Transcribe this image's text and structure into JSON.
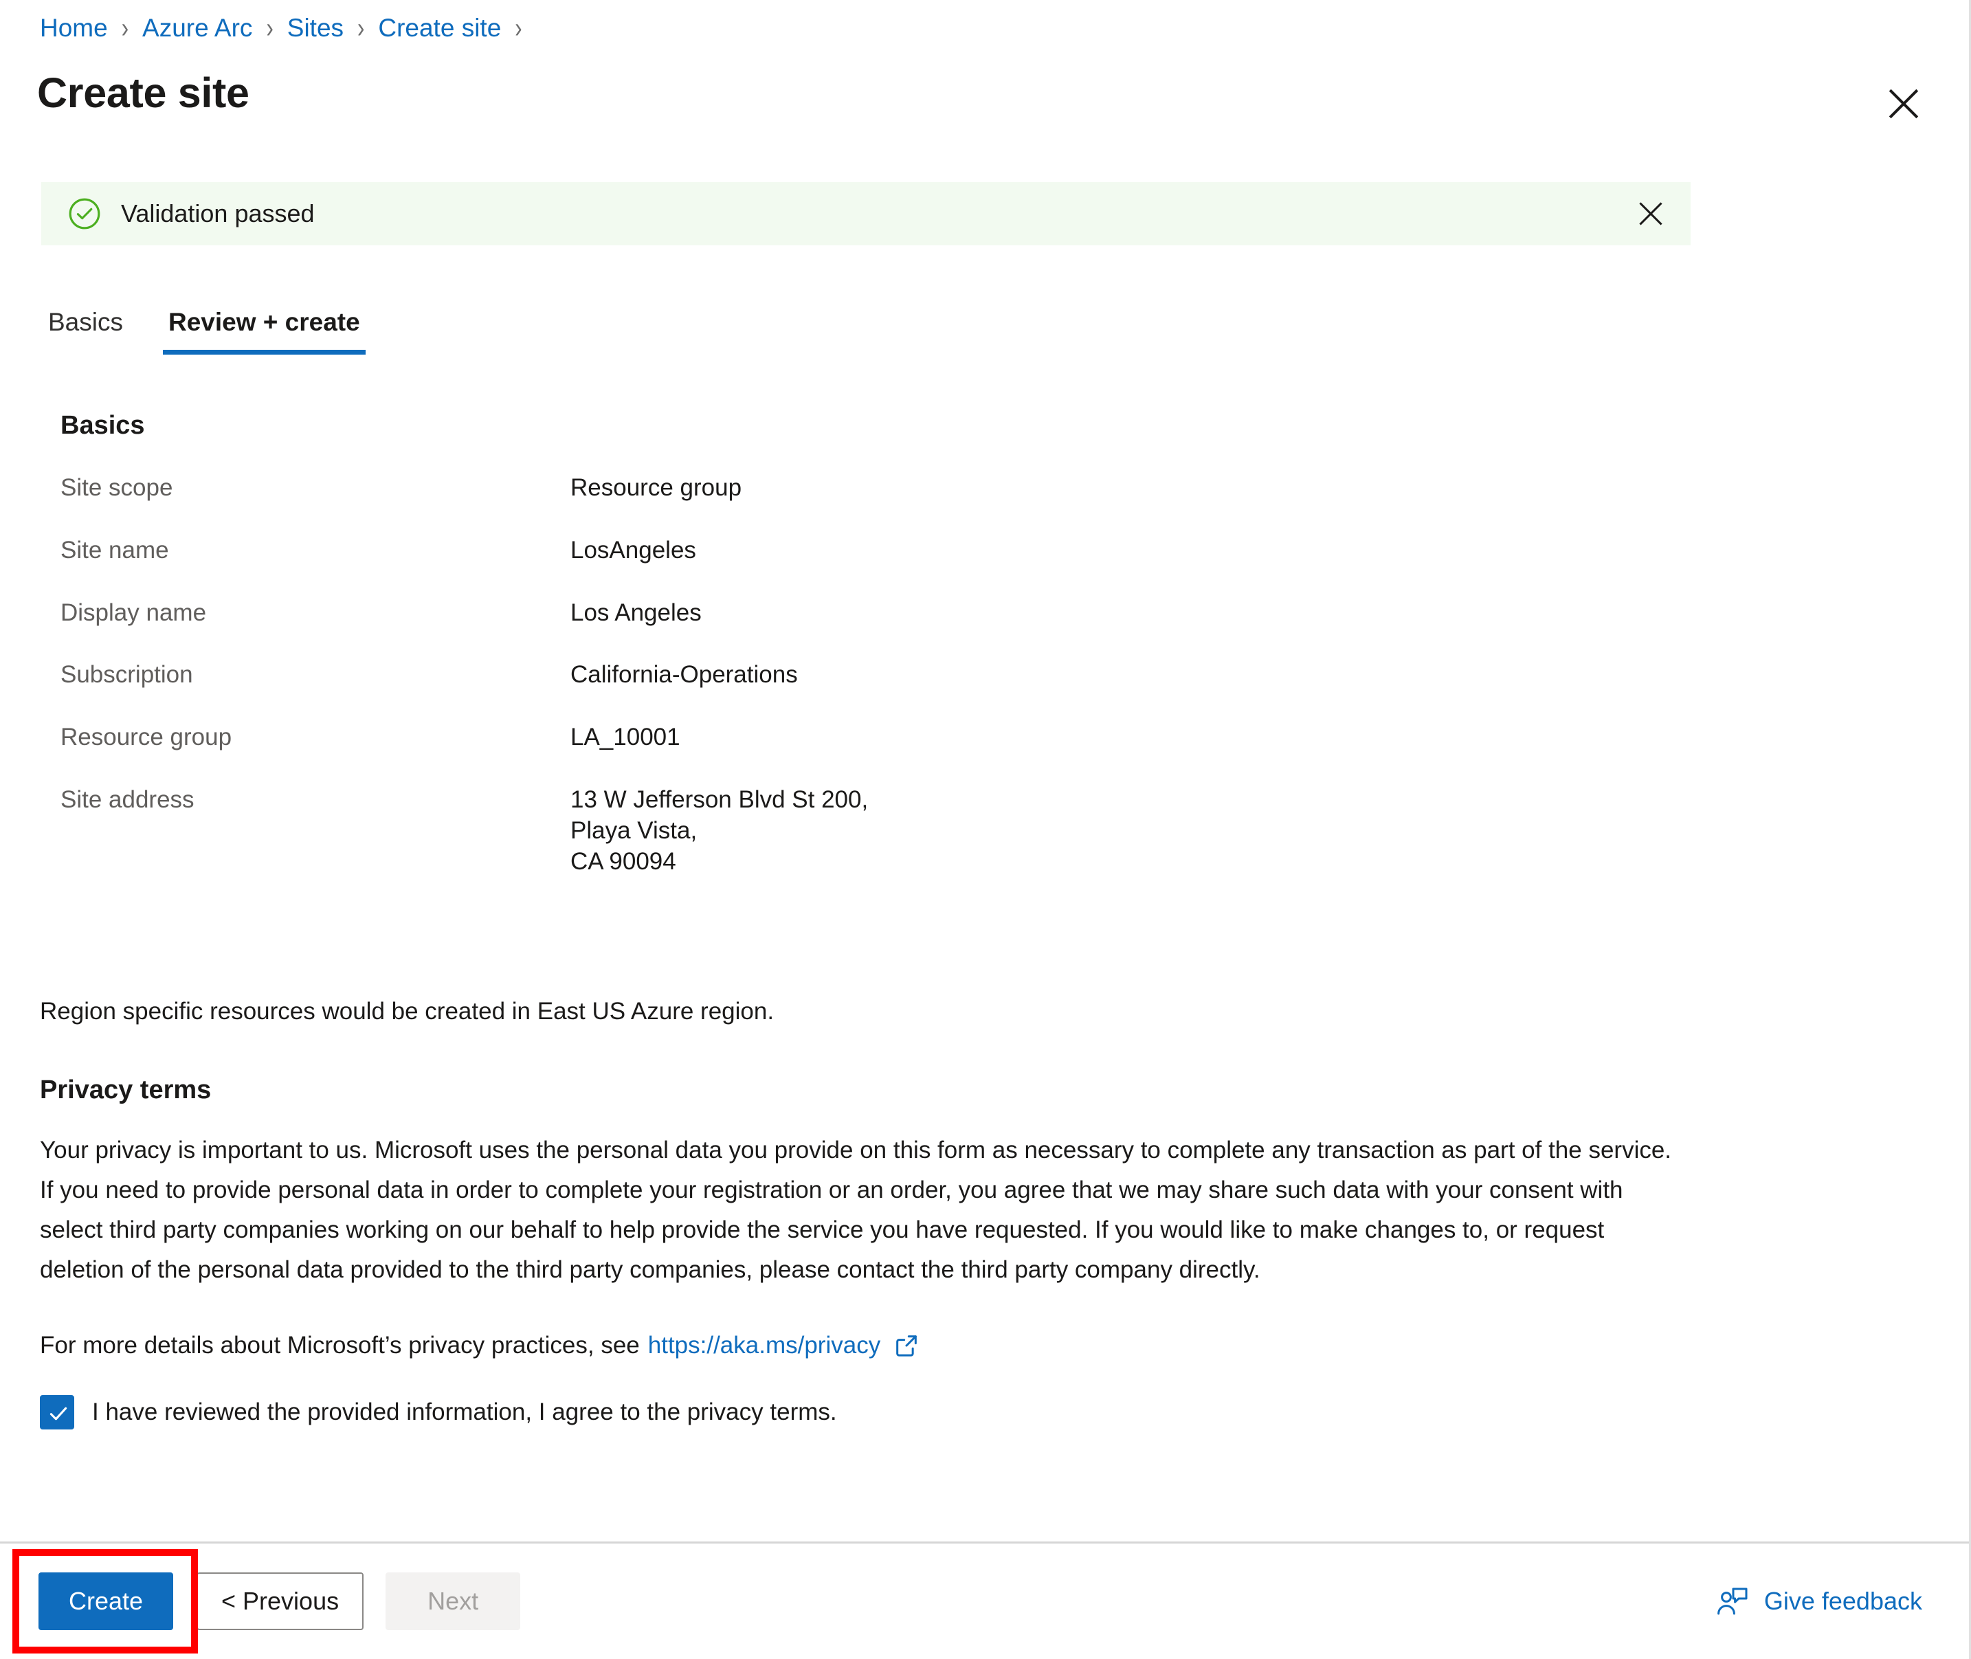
{
  "breadcrumb": {
    "items": [
      {
        "label": "Home"
      },
      {
        "label": "Azure Arc"
      },
      {
        "label": "Sites"
      },
      {
        "label": "Create site"
      }
    ],
    "separator": "›"
  },
  "header": {
    "title": "Create site",
    "close_icon": "close-icon"
  },
  "banner": {
    "icon": "check-circle-icon",
    "message": "Validation passed",
    "close_icon": "close-icon",
    "background": "#f2faf0",
    "icon_color": "#4caf20"
  },
  "tabs": [
    {
      "label": "Basics",
      "active": false
    },
    {
      "label": "Review + create",
      "active": true
    }
  ],
  "basics": {
    "heading": "Basics",
    "rows": [
      {
        "label": "Site scope",
        "value": "Resource group"
      },
      {
        "label": "Site name",
        "value": "LosAngeles"
      },
      {
        "label": "Display name",
        "value": "Los Angeles"
      },
      {
        "label": "Subscription",
        "value": "California-Operations"
      },
      {
        "label": "Resource group",
        "value": "LA_10001"
      },
      {
        "label": "Site address",
        "value": "13 W Jefferson Blvd St 200,\nPlaya Vista,\nCA 90094"
      }
    ]
  },
  "region_note": "Region specific resources would be created in East US Azure region.",
  "privacy": {
    "heading": "Privacy terms",
    "body": "Your privacy is important to us. Microsoft uses the personal data you provide on this form as necessary to complete any transaction as part of the service. If you need to provide personal data in order to complete your registration or an order, you agree that we may share such data with your consent with select third party companies working on our behalf to help provide the service you have requested. If you would like to make changes to, or request deletion of the personal data provided to the third party companies, please contact the third party company directly.",
    "more_details_prefix": "For more details about Microsoft’s privacy practices, see",
    "link_text": "https://aka.ms/privacy",
    "external_icon": "external-link-icon",
    "consent_label": "I have reviewed the provided information, I agree to the privacy terms.",
    "consent_checked": true
  },
  "footer": {
    "create_label": "Create",
    "previous_label": "< Previous",
    "next_label": "Next",
    "next_disabled": true,
    "feedback_label": "Give feedback",
    "feedback_icon": "person-feedback-icon",
    "highlight_color": "#ff0000"
  },
  "colors": {
    "accent": "#0f6cbd",
    "link": "#0f6cbd",
    "text": "#1b1a19",
    "muted": "#605e5c",
    "success": "#4caf20",
    "highlight": "#ff0000"
  }
}
